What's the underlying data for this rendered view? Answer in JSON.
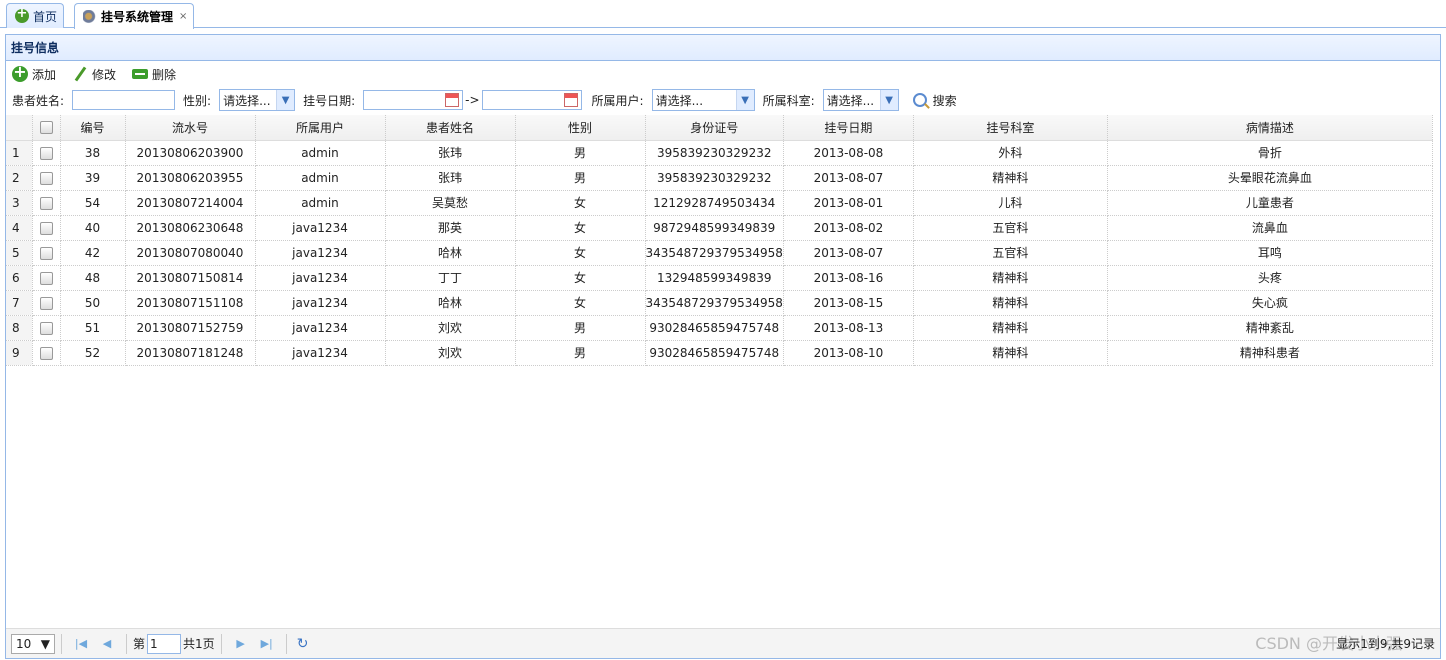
{
  "tabs": [
    {
      "label": "首页",
      "icon": "home-icon"
    },
    {
      "label": "挂号系统管理",
      "icon": "settings-icon",
      "close": "×"
    }
  ],
  "panel": {
    "title": "挂号信息"
  },
  "toolbar": {
    "add": "添加",
    "edit": "修改",
    "delete": "删除"
  },
  "search": {
    "patient_name_label": "患者姓名:",
    "gender_label": "性别:",
    "gender_value": "请选择...",
    "date_label": "挂号日期:",
    "date_sep": "->",
    "user_label": "所属用户:",
    "user_value": "请选择...",
    "dept_label": "所属科室:",
    "dept_value": "请选择...",
    "search_button": "搜索"
  },
  "table": {
    "columns": [
      "编号",
      "流水号",
      "所属用户",
      "患者姓名",
      "性别",
      "身份证号",
      "挂号日期",
      "挂号科室",
      "病情描述"
    ],
    "rows": [
      [
        "1",
        "38",
        "20130806203900",
        "admin",
        "张玮",
        "男",
        "395839230329232",
        "2013-08-08",
        "外科",
        "骨折"
      ],
      [
        "2",
        "39",
        "20130806203955",
        "admin",
        "张玮",
        "男",
        "395839230329232",
        "2013-08-07",
        "精神科",
        "头晕眼花流鼻血"
      ],
      [
        "3",
        "54",
        "20130807214004",
        "admin",
        "吴莫愁",
        "女",
        "121292874950343​4",
        "2013-08-01",
        "儿科",
        "儿童患者"
      ],
      [
        "4",
        "40",
        "20130806230648",
        "java1234",
        "那英",
        "女",
        "9872948599349839",
        "2013-08-02",
        "五官科",
        "流鼻血"
      ],
      [
        "5",
        "42",
        "20130807080040",
        "java1234",
        "哈林",
        "女",
        "343548729379534958",
        "2013-08-07",
        "五官科",
        "耳鸣"
      ],
      [
        "6",
        "48",
        "20130807150814",
        "java1234",
        "丁丁",
        "女",
        "132948599349839",
        "2013-08-16",
        "精神科",
        "头疼"
      ],
      [
        "7",
        "50",
        "20130807151108",
        "java1234",
        "哈林",
        "女",
        "343548729379534958",
        "2013-08-15",
        "精神科",
        "失心疯"
      ],
      [
        "8",
        "51",
        "20130807152759",
        "java1234",
        "刘欢",
        "男",
        "93028465859475748",
        "2013-08-13",
        "精神科",
        "精神紊乱"
      ],
      [
        "9",
        "52",
        "20130807181248",
        "java1234",
        "刘欢",
        "男",
        "93028465859475748",
        "2013-08-10",
        "精神科",
        "精神科患者"
      ]
    ]
  },
  "pager": {
    "page_size": "10",
    "page_prefix": "第",
    "page_value": "1",
    "page_total": "共1页",
    "info": "显示1到9,共9记录"
  },
  "watermark": "CSDN @开发小小强"
}
